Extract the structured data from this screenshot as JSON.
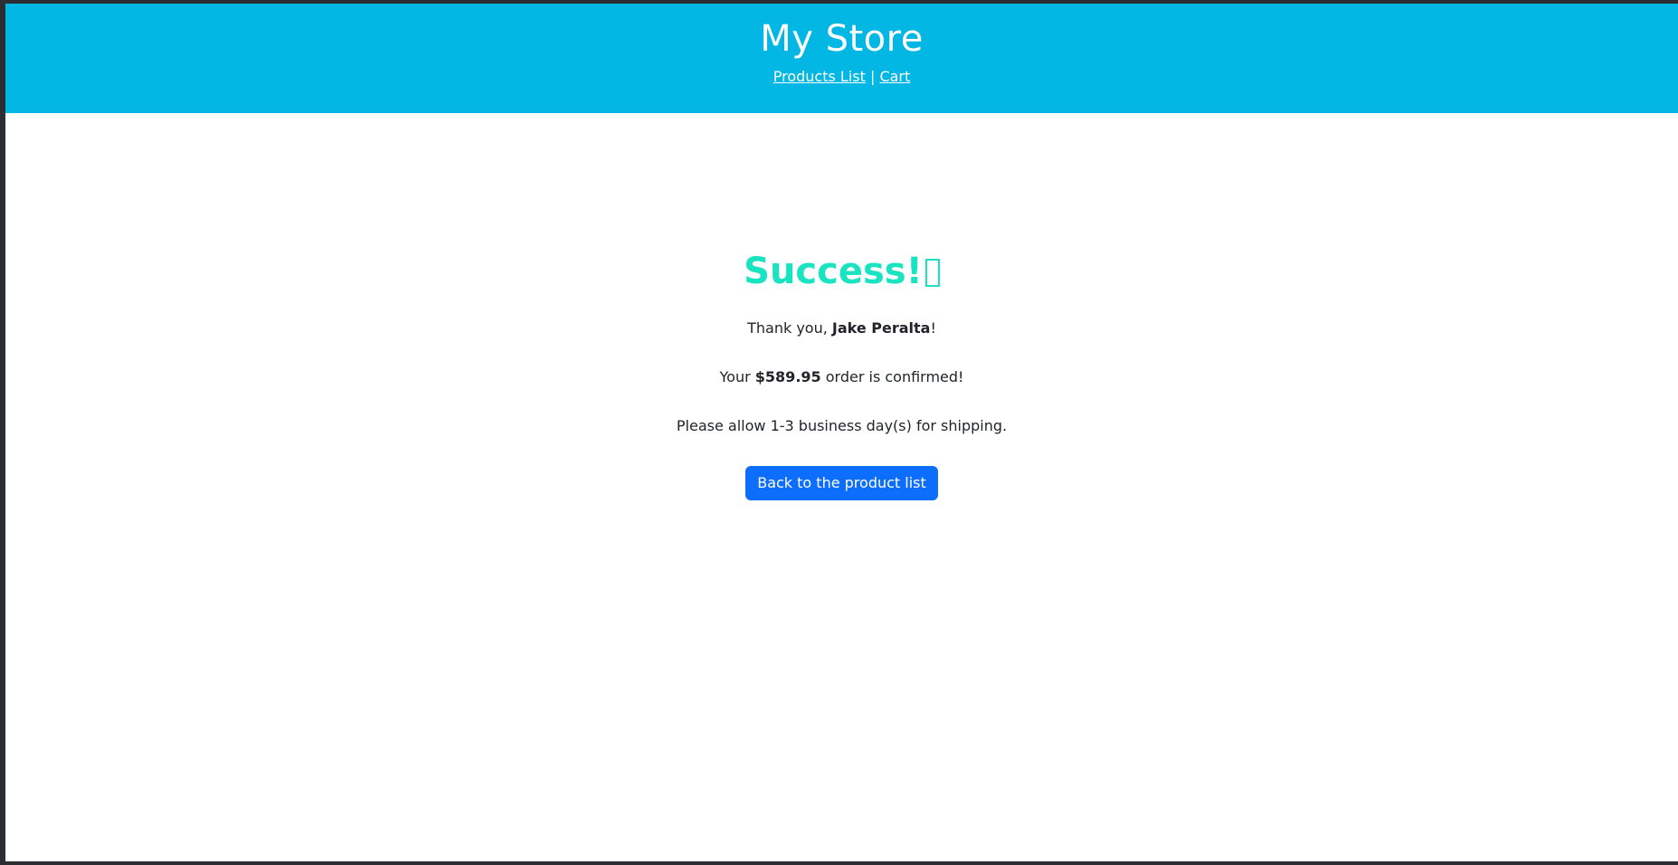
{
  "header": {
    "title": "My Store",
    "nav": {
      "products_link": "Products List",
      "separator": " | ",
      "cart_link": "Cart"
    },
    "background_color": "#02b7e3"
  },
  "confirmation": {
    "heading": "Success!",
    "heading_color": "#19e3c0",
    "heading_glyph_icon": "missing-glyph-box",
    "thanks_prefix": "Thank you, ",
    "customer_name": "Jake Peralta",
    "thanks_suffix": "!",
    "order_prefix": "Your ",
    "order_total": "$589.95",
    "order_suffix": " order is confirmed!",
    "shipping_note": "Please allow 1-3 business day(s) for shipping.",
    "back_button_label": "Back to the product list",
    "button_color": "#0d6efd"
  }
}
